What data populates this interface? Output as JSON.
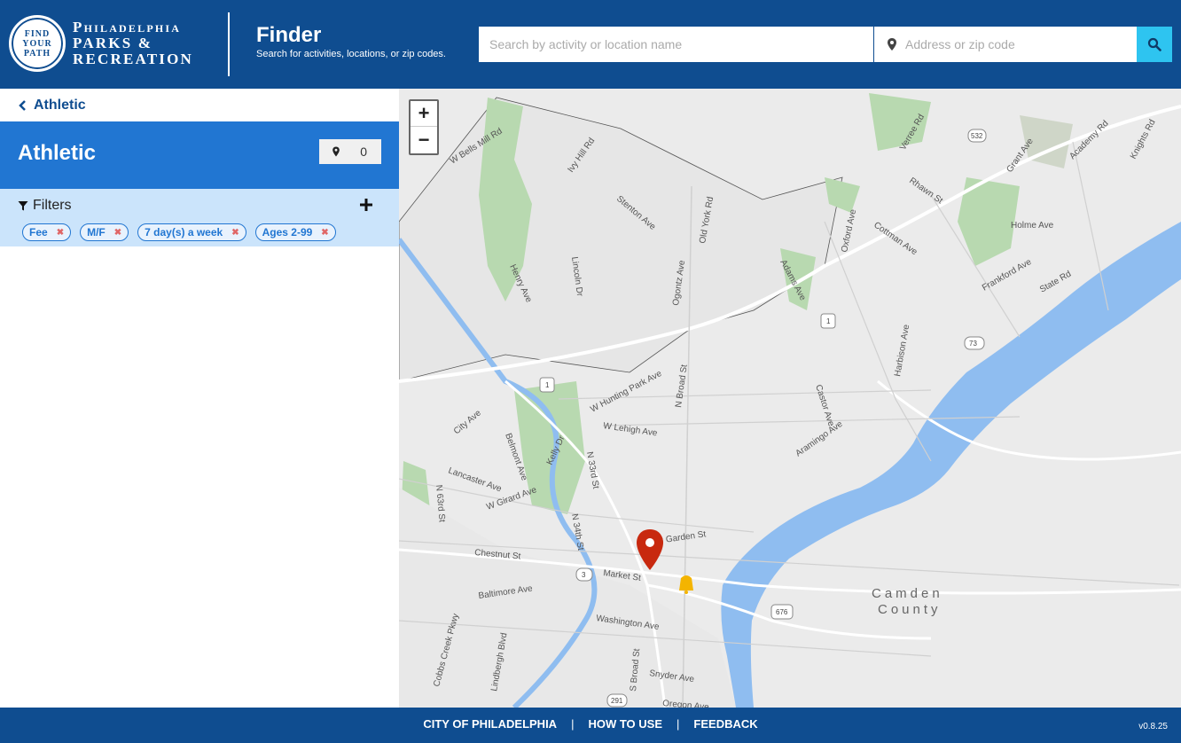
{
  "header": {
    "logo_badge_lines": [
      "FIND",
      "YOUR",
      "PATH"
    ],
    "logo_lines": [
      "Philadelphia",
      "Parks &",
      "Recreation"
    ],
    "app_title": "Finder",
    "app_subtitle": "Search for activities, locations, or zip codes.",
    "search_placeholder": "Search by activity or location name",
    "address_placeholder": "Address or zip code"
  },
  "sidebar": {
    "back_label": "Athletic",
    "category_title": "Athletic",
    "location_count": "0",
    "filters_label": "Filters",
    "filter_tags": [
      "Fee",
      "M/F",
      "7 day(s) a week",
      "Ages 2-99"
    ]
  },
  "map": {
    "zoom_in": "+",
    "zoom_out": "−",
    "street_labels": [
      "W Bells Mill Rd",
      "Ivy Hill Rd",
      "Stenton Ave",
      "Old York Rd",
      "Henry Ave",
      "Lincoln Dr",
      "Ogontz Ave",
      "Adams Ave",
      "Oxford Ave",
      "Cottman Ave",
      "Verree Rd",
      "Rhawn St",
      "Grant Ave",
      "Academy Rd",
      "Knights Rd",
      "Holme Ave",
      "Frankford Ave",
      "State Rd",
      "Harbison Ave",
      "N Broad St",
      "W Hunting Park Ave",
      "W Lehigh Ave",
      "Castor Ave",
      "Aramingo Ave",
      "City Ave",
      "Belmont Ave",
      "Kelly Dr",
      "N 33rd St",
      "Lancaster Ave",
      "N 63rd St",
      "W Girard Ave",
      "N 34th St",
      "Spring Garden St",
      "Chestnut St",
      "Market St",
      "Baltimore Ave",
      "Washington Ave",
      "Snyder Ave",
      "Oregon Ave",
      "S Broad St",
      "Lindbergh Blvd",
      "Cobbs Creek Pkwy"
    ],
    "route_shields": [
      "532",
      "1",
      "73",
      "1",
      "3",
      "676",
      "291"
    ],
    "county_label": [
      "Camden",
      "County"
    ]
  },
  "footer": {
    "links": [
      "CITY OF PHILADELPHIA",
      "HOW TO USE",
      "FEEDBACK"
    ],
    "separator": "|",
    "version": "v0.8.25"
  },
  "colors": {
    "header_bg": "#0f4d90",
    "category_bg": "#2176d2",
    "filters_bg": "#cbe4fb",
    "search_button": "#2ec4f0",
    "map_marker": "#c8290f"
  }
}
